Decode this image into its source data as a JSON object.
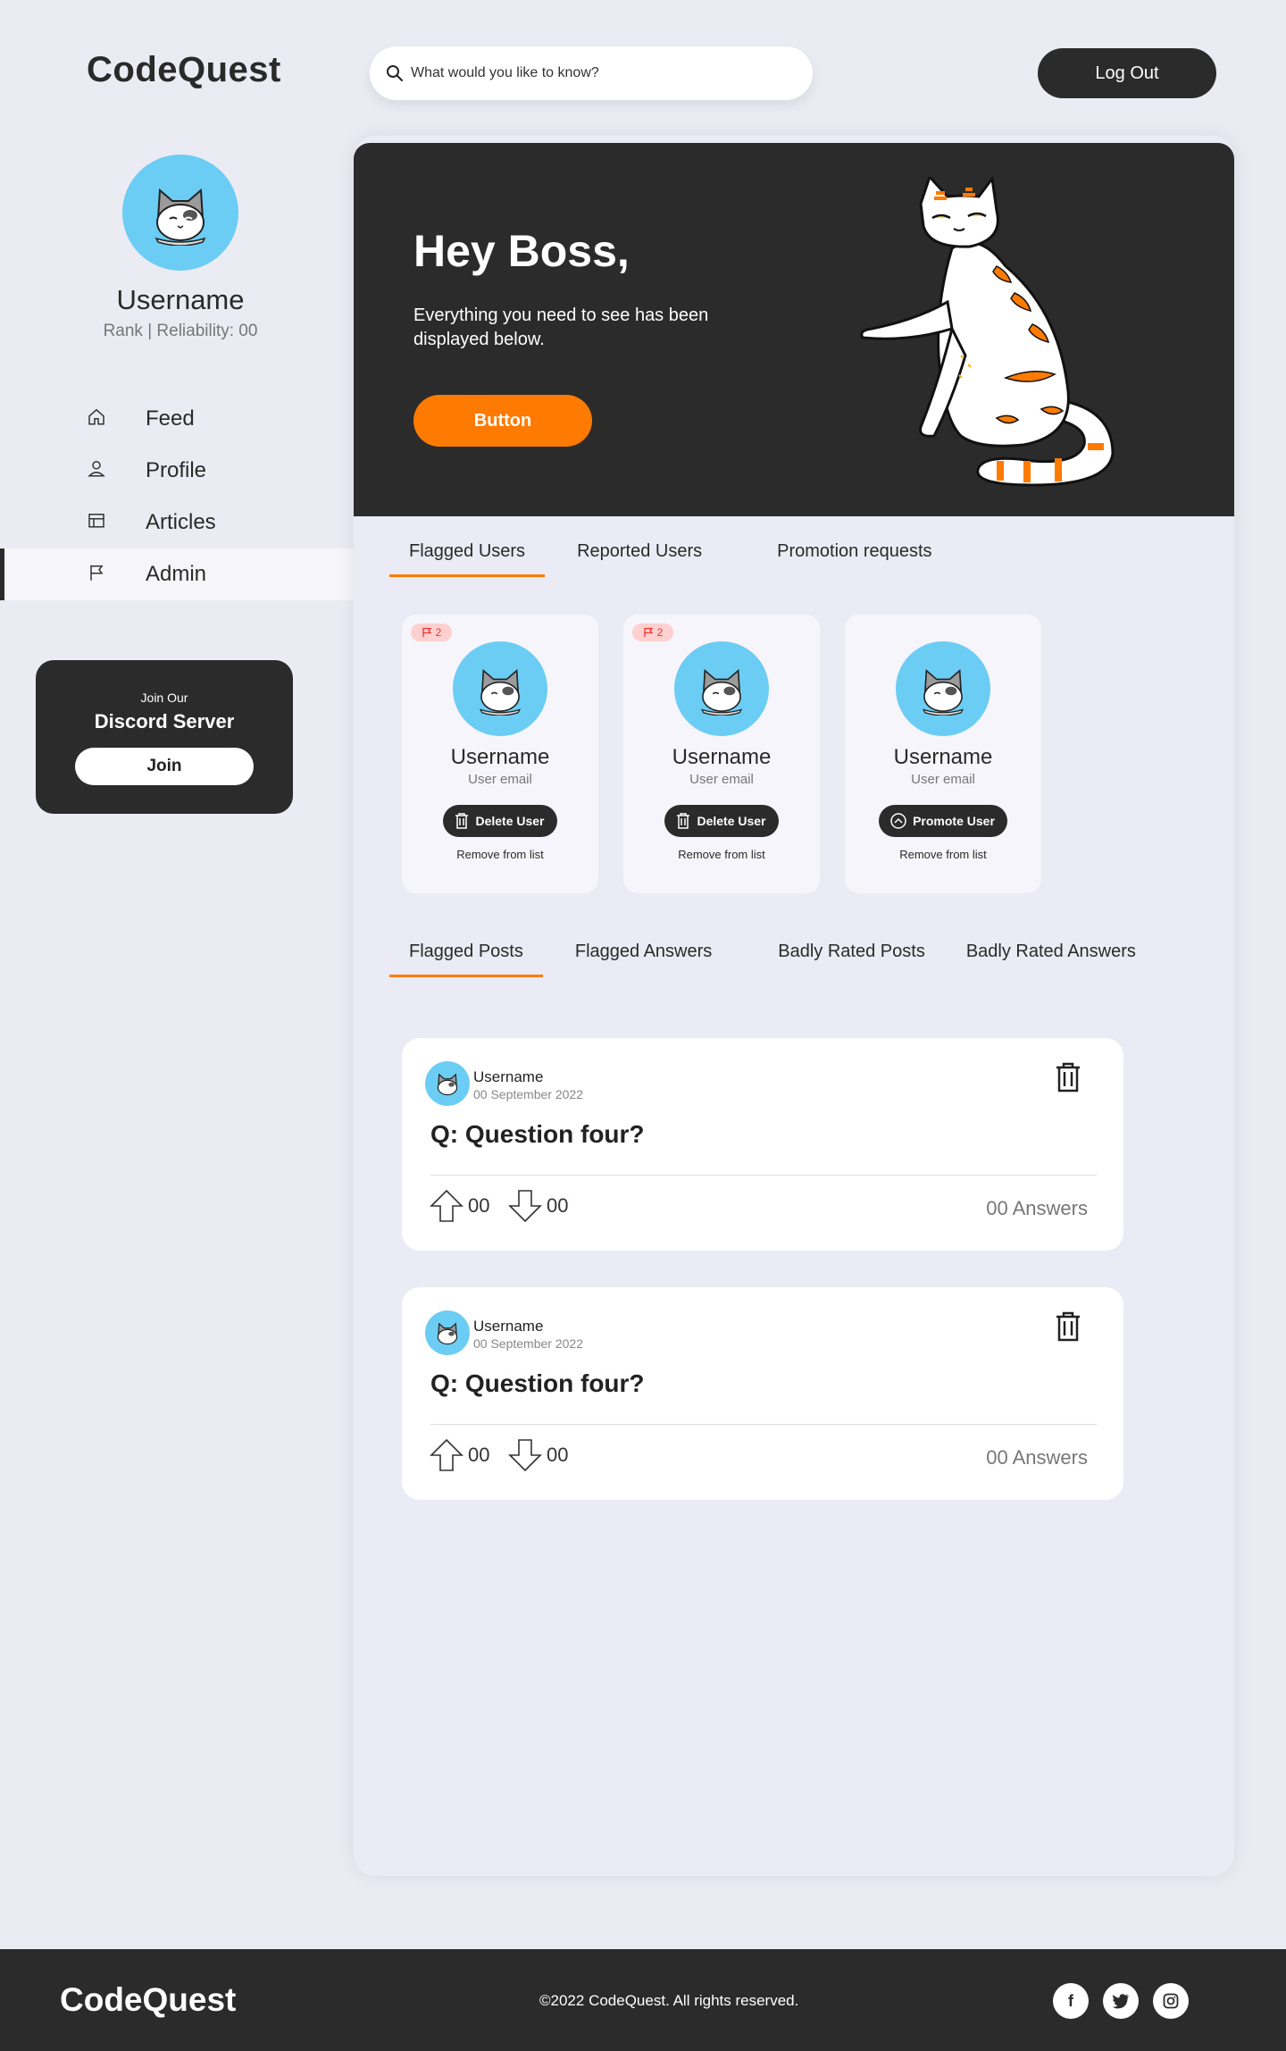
{
  "app": {
    "logo": "CodeQuest"
  },
  "search": {
    "placeholder": "What would you like to know?"
  },
  "header": {
    "logout_label": "Log Out"
  },
  "profile": {
    "username": "Username",
    "rank": "Rank | Reliability: 00"
  },
  "nav": {
    "items": [
      {
        "label": "Feed",
        "icon": "home-icon",
        "active": false
      },
      {
        "label": "Profile",
        "icon": "user-icon",
        "active": false
      },
      {
        "label": "Articles",
        "icon": "articles-icon",
        "active": false
      },
      {
        "label": "Admin",
        "icon": "flag-icon",
        "active": true
      }
    ]
  },
  "discord": {
    "small": "Join Our",
    "title": "Discord Server",
    "button": "Join"
  },
  "hero": {
    "title": "Hey Boss,",
    "text": "Everything you need to see has been displayed below.",
    "button": "Button"
  },
  "user_tabs": [
    {
      "label": "Flagged Users",
      "active": true
    },
    {
      "label": "Reported Users",
      "active": false
    },
    {
      "label": "Promotion requests",
      "active": false
    }
  ],
  "user_cards": [
    {
      "flag_count": "2",
      "username": "Username",
      "email": "User email",
      "action": "Delete User",
      "action_icon": "trash-icon",
      "remove": "Remove from list"
    },
    {
      "flag_count": "2",
      "username": "Username",
      "email": "User email",
      "action": "Delete User",
      "action_icon": "trash-icon",
      "remove": "Remove from list"
    },
    {
      "flag_count": "",
      "username": "Username",
      "email": "User email",
      "action": "Promote User",
      "action_icon": "chevron-up-icon",
      "remove": "Remove from list"
    }
  ],
  "post_tabs": [
    {
      "label": "Flagged Posts",
      "active": true
    },
    {
      "label": "Flagged Answers",
      "active": false
    },
    {
      "label": "Badly Rated Posts",
      "active": false
    },
    {
      "label": "Badly Rated Answers",
      "active": false
    }
  ],
  "posts": [
    {
      "username": "Username",
      "date": "00 September 2022",
      "question": "Q: Question four?",
      "upvotes": "00",
      "downvotes": "00",
      "answers": "00 Answers"
    },
    {
      "username": "Username",
      "date": "00 September 2022",
      "question": "Q: Question four?",
      "upvotes": "00",
      "downvotes": "00",
      "answers": "00 Answers"
    }
  ],
  "footer": {
    "logo": "CodeQuest",
    "copyright": "©2022 CodeQuest. All rights reserved.",
    "social": [
      "facebook-icon",
      "twitter-icon",
      "instagram-icon"
    ]
  },
  "colors": {
    "accent": "#ff7a00",
    "dark": "#2b2b2b",
    "avatar_bg": "#6ccdf4",
    "background": "#ebebf4"
  }
}
